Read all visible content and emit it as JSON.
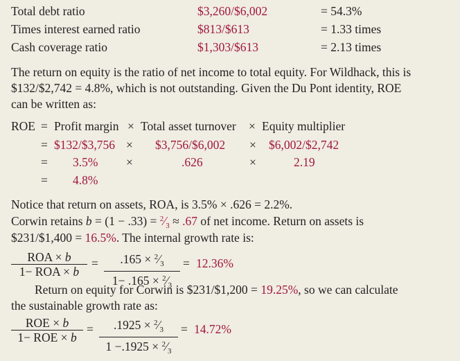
{
  "ratios": [
    {
      "label": "Total debt ratio",
      "calc": "$3,260/$6,002",
      "result": "= 54.3%"
    },
    {
      "label": "Times interest earned ratio",
      "calc": "$813/$613",
      "result": "= 1.33 times"
    },
    {
      "label": "Cash coverage ratio",
      "calc": "$1,303/$613",
      "result": "= 2.13 times"
    }
  ],
  "para1": {
    "line1": "The return on equity is the ratio of net income to total equity. For Wildhack, this is",
    "line2": "$132/$2,742 = 4.8%, which is not outstanding. Given the Du Pont identity, ROE",
    "line3": "can be written as:"
  },
  "dupont": {
    "lhs": "ROE",
    "eq": "=",
    "terms": [
      "Profit margin",
      "Total asset turnover",
      "Equity multiplier"
    ],
    "times": "×",
    "row2": [
      "$132/$3,756",
      "$3,756/$6,002",
      "$6,002/$2,742"
    ],
    "row3": [
      "3.5%",
      ".626",
      "2.19"
    ],
    "row4": "4.8%"
  },
  "para2": {
    "line1": "Notice that return on assets, ROA, is 3.5% × .626 = 2.2%.",
    "line2_a": "Corwin retains ",
    "line2_b": "b",
    "line2_c": " = (1 − .33) = ",
    "line2_frac_num": "2",
    "line2_frac_den": "3",
    "line2_d": " ≈ ",
    "line2_e": ".67",
    "line2_f": " of net income. Return on assets is",
    "line3_a": "$231/$1,400 = ",
    "line3_b": "16.5%",
    "line3_c": ". The internal growth rate is:"
  },
  "igr": {
    "num1": "ROA × ",
    "den1": "1− ROA × ",
    "var": "b",
    "num2": ".165 × ",
    "den2": "1− .165 × ",
    "frac_num": "2",
    "frac_den": "3",
    "eq": "=",
    "result": "12.36%"
  },
  "para3": {
    "line1_a": "Return on equity for Corwin is $231/$1,200 = ",
    "line1_b": "19.25%",
    "line1_c": ", so we can calculate",
    "line2": "the sustainable growth rate as:"
  },
  "sgr": {
    "num1": "ROE × ",
    "den1": "1− ROE × ",
    "var": "b",
    "num2": ".1925 × ",
    "den2": "1 −.1925 × ",
    "frac_num": "2",
    "frac_den": "3",
    "eq": "=",
    "result": "14.72%"
  }
}
